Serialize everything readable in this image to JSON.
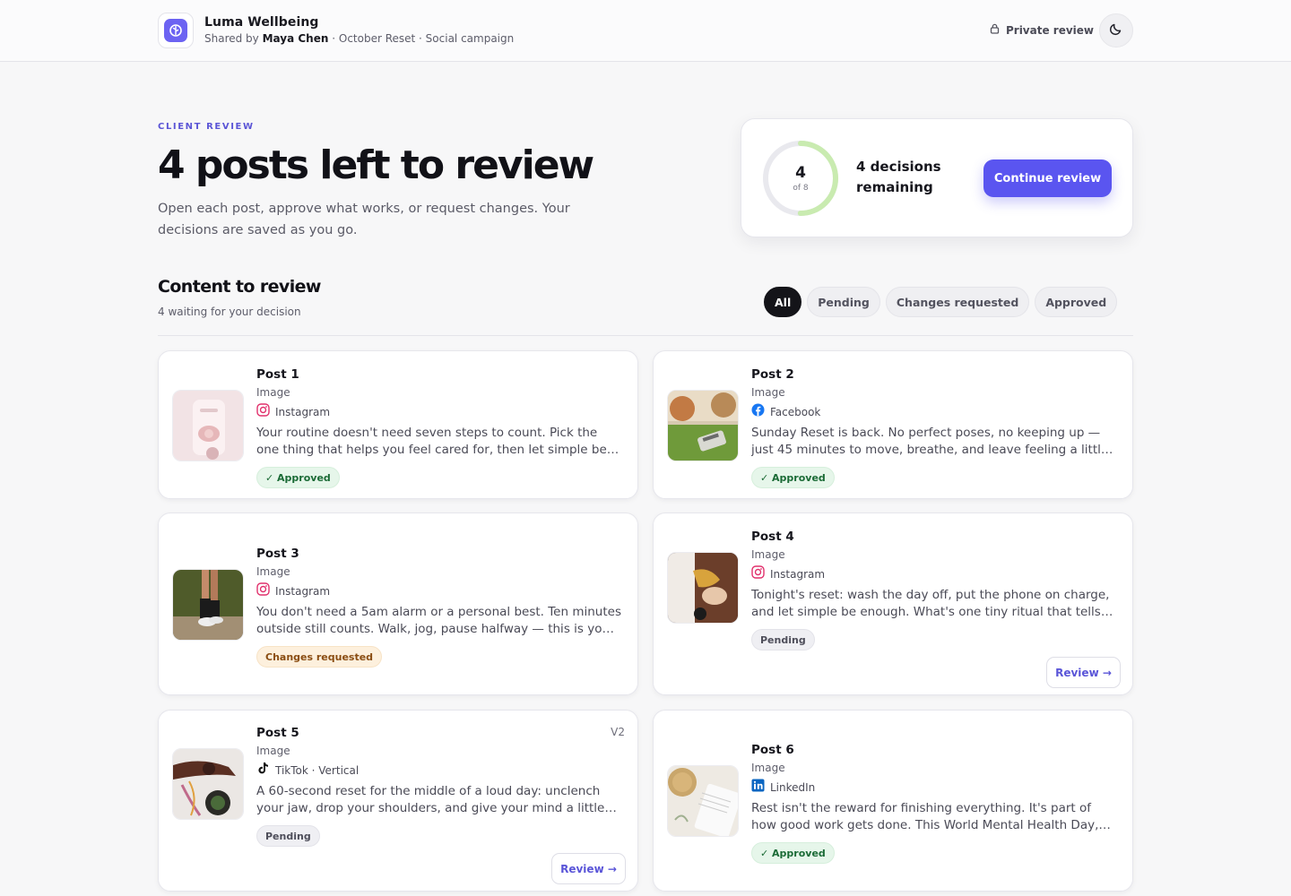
{
  "header": {
    "brand_name": "Luma Wellbeing",
    "shared_prefix": "Shared by",
    "shared_by": "Maya Chen",
    "shared_suffix": "· October Reset · Social campaign",
    "private_label": "Private review"
  },
  "hero": {
    "eyebrow": "CLIENT REVIEW",
    "title": "4 posts left to review",
    "description": "Open each post, approve what works, or request changes. Your decisions are saved as you go."
  },
  "progress": {
    "remaining": "4",
    "of_label": "of 8",
    "fraction_reviewed": 0.5,
    "remaining_text": "4 decisions remaining",
    "cta": "Continue review"
  },
  "section": {
    "title": "Content to review",
    "subtitle": "4 waiting for your decision"
  },
  "filters": [
    "All",
    "Pending",
    "Changes requested",
    "Approved"
  ],
  "colors": {
    "accent": "#5a55f0",
    "approved": "#1b6b36",
    "changes": "#8a4d12",
    "ring_progress": "#c9ebb0",
    "ring_track": "#e9e9ee"
  },
  "posts": [
    {
      "title": "Post 1",
      "type": "Image",
      "platform": "Instagram",
      "platform_icon": "instagram-icon",
      "caption": "Your routine doesn't need seven steps to count. Pick the one thing that helps you feel cared for, then let simple be enough. Save this for the evenings when everything feels like too much.",
      "status": "✓ Approved",
      "status_kind": "approved",
      "version": "",
      "review": ""
    },
    {
      "title": "Post 2",
      "type": "Image",
      "platform": "Facebook",
      "platform_icon": "facebook-icon",
      "caption": "Sunday Reset is back. No perfect poses, no keeping up — just 45 minutes to move, breathe, and leave feeling a little lighter. First session is free for members.",
      "status": "✓ Approved",
      "status_kind": "approved",
      "version": "",
      "review": ""
    },
    {
      "title": "Post 3",
      "type": "Image",
      "platform": "Instagram",
      "platform_icon": "instagram-icon",
      "caption": "You don't need a 5am alarm or a personal best. Ten minutes outside still counts. Walk, jog, pause halfway — this is your reset, on your terms.",
      "status": "Changes requested",
      "status_kind": "changes",
      "version": "",
      "review": ""
    },
    {
      "title": "Post 4",
      "type": "Image",
      "platform": "Instagram",
      "platform_icon": "instagram-icon",
      "caption": "Tonight's reset: wash the day off, put the phone on charge, and let simple be enough. What's one tiny ritual that tells your brain the day is done?",
      "status": "Pending",
      "status_kind": "pending",
      "version": "",
      "review": "Review →"
    },
    {
      "title": "Post 5",
      "type": "Image",
      "platform": "TikTok · Vertical",
      "platform_icon": "tiktok-icon",
      "caption": "A 60-second reset for the middle of a loud day: unclench your jaw, drop your shoulders, and give your mind a little room. Follow along and try it before your next meeting.",
      "status": "Pending",
      "status_kind": "pending",
      "version": "V2",
      "review": "Review →"
    },
    {
      "title": "Post 6",
      "type": "Image",
      "platform": "LinkedIn",
      "platform_icon": "linkedin-icon",
      "caption": "Rest isn't the reward for finishing everything. It's part of how good work gets done. This World Mental Health Day, we're giving our whole team the afternoon off.",
      "status": "✓ Approved",
      "status_kind": "approved",
      "version": "",
      "review": ""
    }
  ]
}
